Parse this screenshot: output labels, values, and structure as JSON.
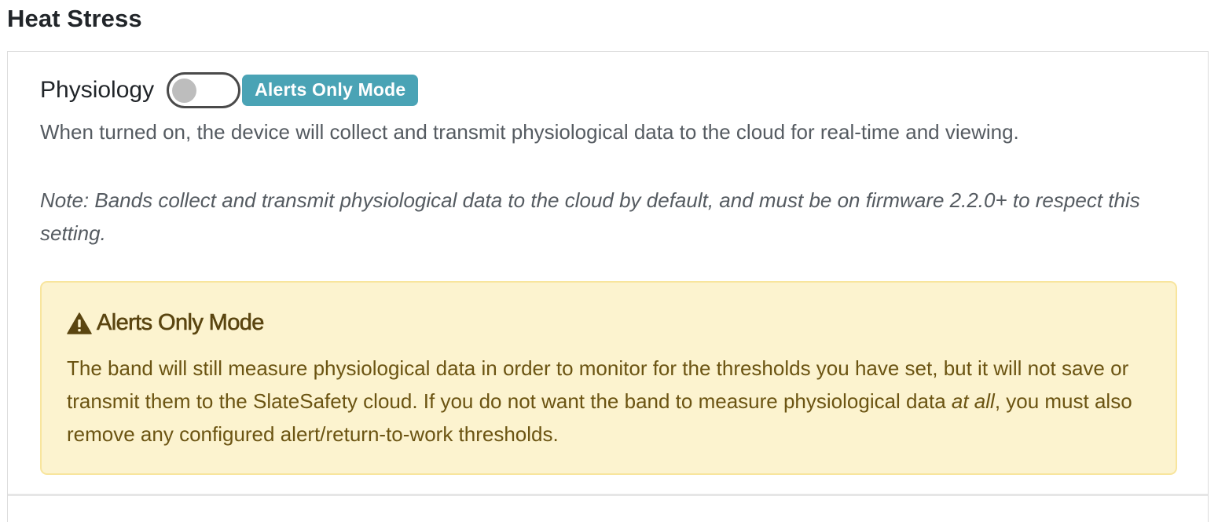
{
  "section": {
    "title": "Heat Stress"
  },
  "physiology": {
    "label": "Physiology",
    "toggle_on": false,
    "badge": "Alerts Only Mode",
    "badge_color": "#4aa3b5",
    "description": "When turned on, the device will collect and transmit physiological data to the cloud for real-time and viewing.",
    "note": "Note: Bands collect and transmit physiological data to the cloud by default, and must be on firmware 2.2.0+ to respect this setting."
  },
  "alert": {
    "icon": "warning-triangle-icon",
    "heading": "Alerts Only Mode",
    "body_part1": "The band will still measure physiological data in order to monitor for the thresholds you have set, but it will not save or transmit them to the SlateSafety cloud. If you do not want the band to measure physiological data ",
    "body_emphasis": "at all",
    "body_part2": ", you must also remove any configured alert/return-to-work thresholds.",
    "background_color": "#fcf3cf",
    "border_color": "#f8e59d"
  }
}
